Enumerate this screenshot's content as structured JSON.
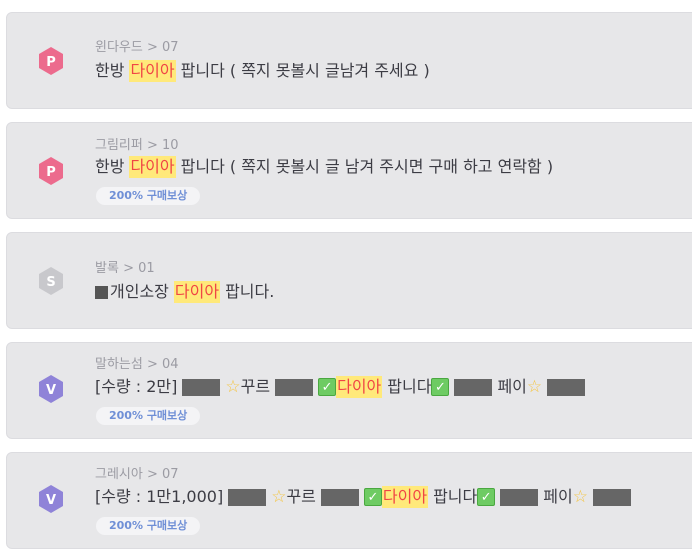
{
  "highlight_word": "다이아",
  "cards": [
    {
      "server": "윈다우드",
      "separator": ">",
      "channel": "07",
      "badge": "P",
      "title_before": "한방",
      "title_after": "팝니다 ( 쪽지 못볼시 글남겨 주세요 )"
    },
    {
      "server": "그림리퍼",
      "separator": ">",
      "channel": "10",
      "badge": "P",
      "title_before": "한방",
      "title_after": "팝니다 ( 쪽지 못볼시 글 남겨 주시면 구매 하고 연락함 )",
      "reward": "200% 구매보상"
    },
    {
      "server": "발록",
      "separator": ">",
      "channel": "01",
      "badge": "S",
      "title_before": "개인소장",
      "title_after": "팝니다."
    },
    {
      "server": "말하는섬",
      "separator": ">",
      "channel": "04",
      "badge": "V",
      "title_prefix": "[수량 : 2만]",
      "title_mid1": "꾸르",
      "title_after": "팝니다",
      "title_end": "페이",
      "reward": "200% 구매보상"
    },
    {
      "server": "그레시아",
      "separator": ">",
      "channel": "07",
      "badge": "V",
      "title_prefix": "[수량 : 1만1,000]",
      "title_mid1": "꾸르",
      "title_after": "팝니다",
      "title_end": "페이",
      "reward": "200% 구매보상"
    }
  ],
  "colors": {
    "card_bg": "#e7e7e9",
    "badge_p": "#ec6b8d",
    "badge_s": "#c8c8cc",
    "badge_v": "#8f83d8",
    "highlight_bg": "#ffe97a",
    "highlight_text": "#f04545",
    "reward_text": "#6f8fd6"
  },
  "icons": {
    "badge_p": "hexagon-p-icon",
    "badge_s": "hexagon-s-icon",
    "badge_v": "hexagon-v-icon",
    "star": "star-icon",
    "check": "check-icon"
  }
}
